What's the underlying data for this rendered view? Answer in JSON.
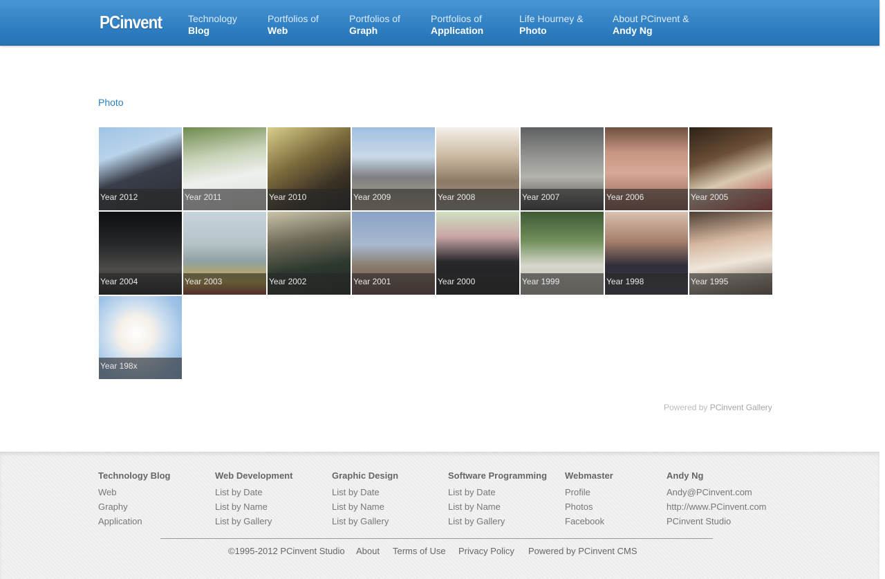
{
  "header": {
    "brand": "PCinvent",
    "nav": [
      {
        "top": "Technology",
        "bottom": "Blog"
      },
      {
        "top": "Portfolios of",
        "bottom": "Web"
      },
      {
        "top": "Portfolios of",
        "bottom": "Graph"
      },
      {
        "top": "Portfolios of",
        "bottom": "Application"
      },
      {
        "top": "Life Hourney &",
        "bottom": "Photo"
      },
      {
        "top": "About PCinvent &",
        "bottom": "Andy Ng"
      }
    ]
  },
  "main": {
    "title": "Photo",
    "albums": [
      {
        "label": "Year 2012"
      },
      {
        "label": "Year 2011"
      },
      {
        "label": "Year 2010"
      },
      {
        "label": "Year 2009"
      },
      {
        "label": "Year 2008"
      },
      {
        "label": "Year 2007"
      },
      {
        "label": "Year 2006"
      },
      {
        "label": "Year 2005"
      },
      {
        "label": "Year 2004"
      },
      {
        "label": "Year 2003"
      },
      {
        "label": "Year 2002"
      },
      {
        "label": "Year 2001"
      },
      {
        "label": "Year 2000"
      },
      {
        "label": "Year 1999"
      },
      {
        "label": "Year 1998"
      },
      {
        "label": "Year 1995"
      },
      {
        "label": "Year 198x"
      }
    ],
    "powered_prefix": "Powered by",
    "powered_link": "PCinvent Gallery"
  },
  "footer": {
    "columns": [
      {
        "heading": "Technology Blog",
        "links": [
          "Web",
          "Graphy",
          "Application"
        ]
      },
      {
        "heading": "Web Development",
        "links": [
          "List by Date",
          "List by Name",
          "List by Gallery"
        ]
      },
      {
        "heading": "Graphic Design",
        "links": [
          "List by Date",
          "List by Name",
          "List by Gallery"
        ]
      },
      {
        "heading": "Software Programming",
        "links": [
          "List by Date",
          "List by Name",
          "List by Gallery"
        ]
      },
      {
        "heading": "Webmaster",
        "links": [
          "Profile",
          "Photos",
          "Facebook"
        ]
      },
      {
        "heading": "Andy Ng",
        "links": [
          "Andy@PCinvent.com",
          "http://www.PCinvent.com",
          "PCinvent Studio"
        ]
      }
    ],
    "copyright": "©1995-2012 PCinvent Studio",
    "bottom_links": [
      "About",
      "Terms of Use",
      "Privacy Policy",
      "Powered by PCinvent CMS"
    ]
  }
}
